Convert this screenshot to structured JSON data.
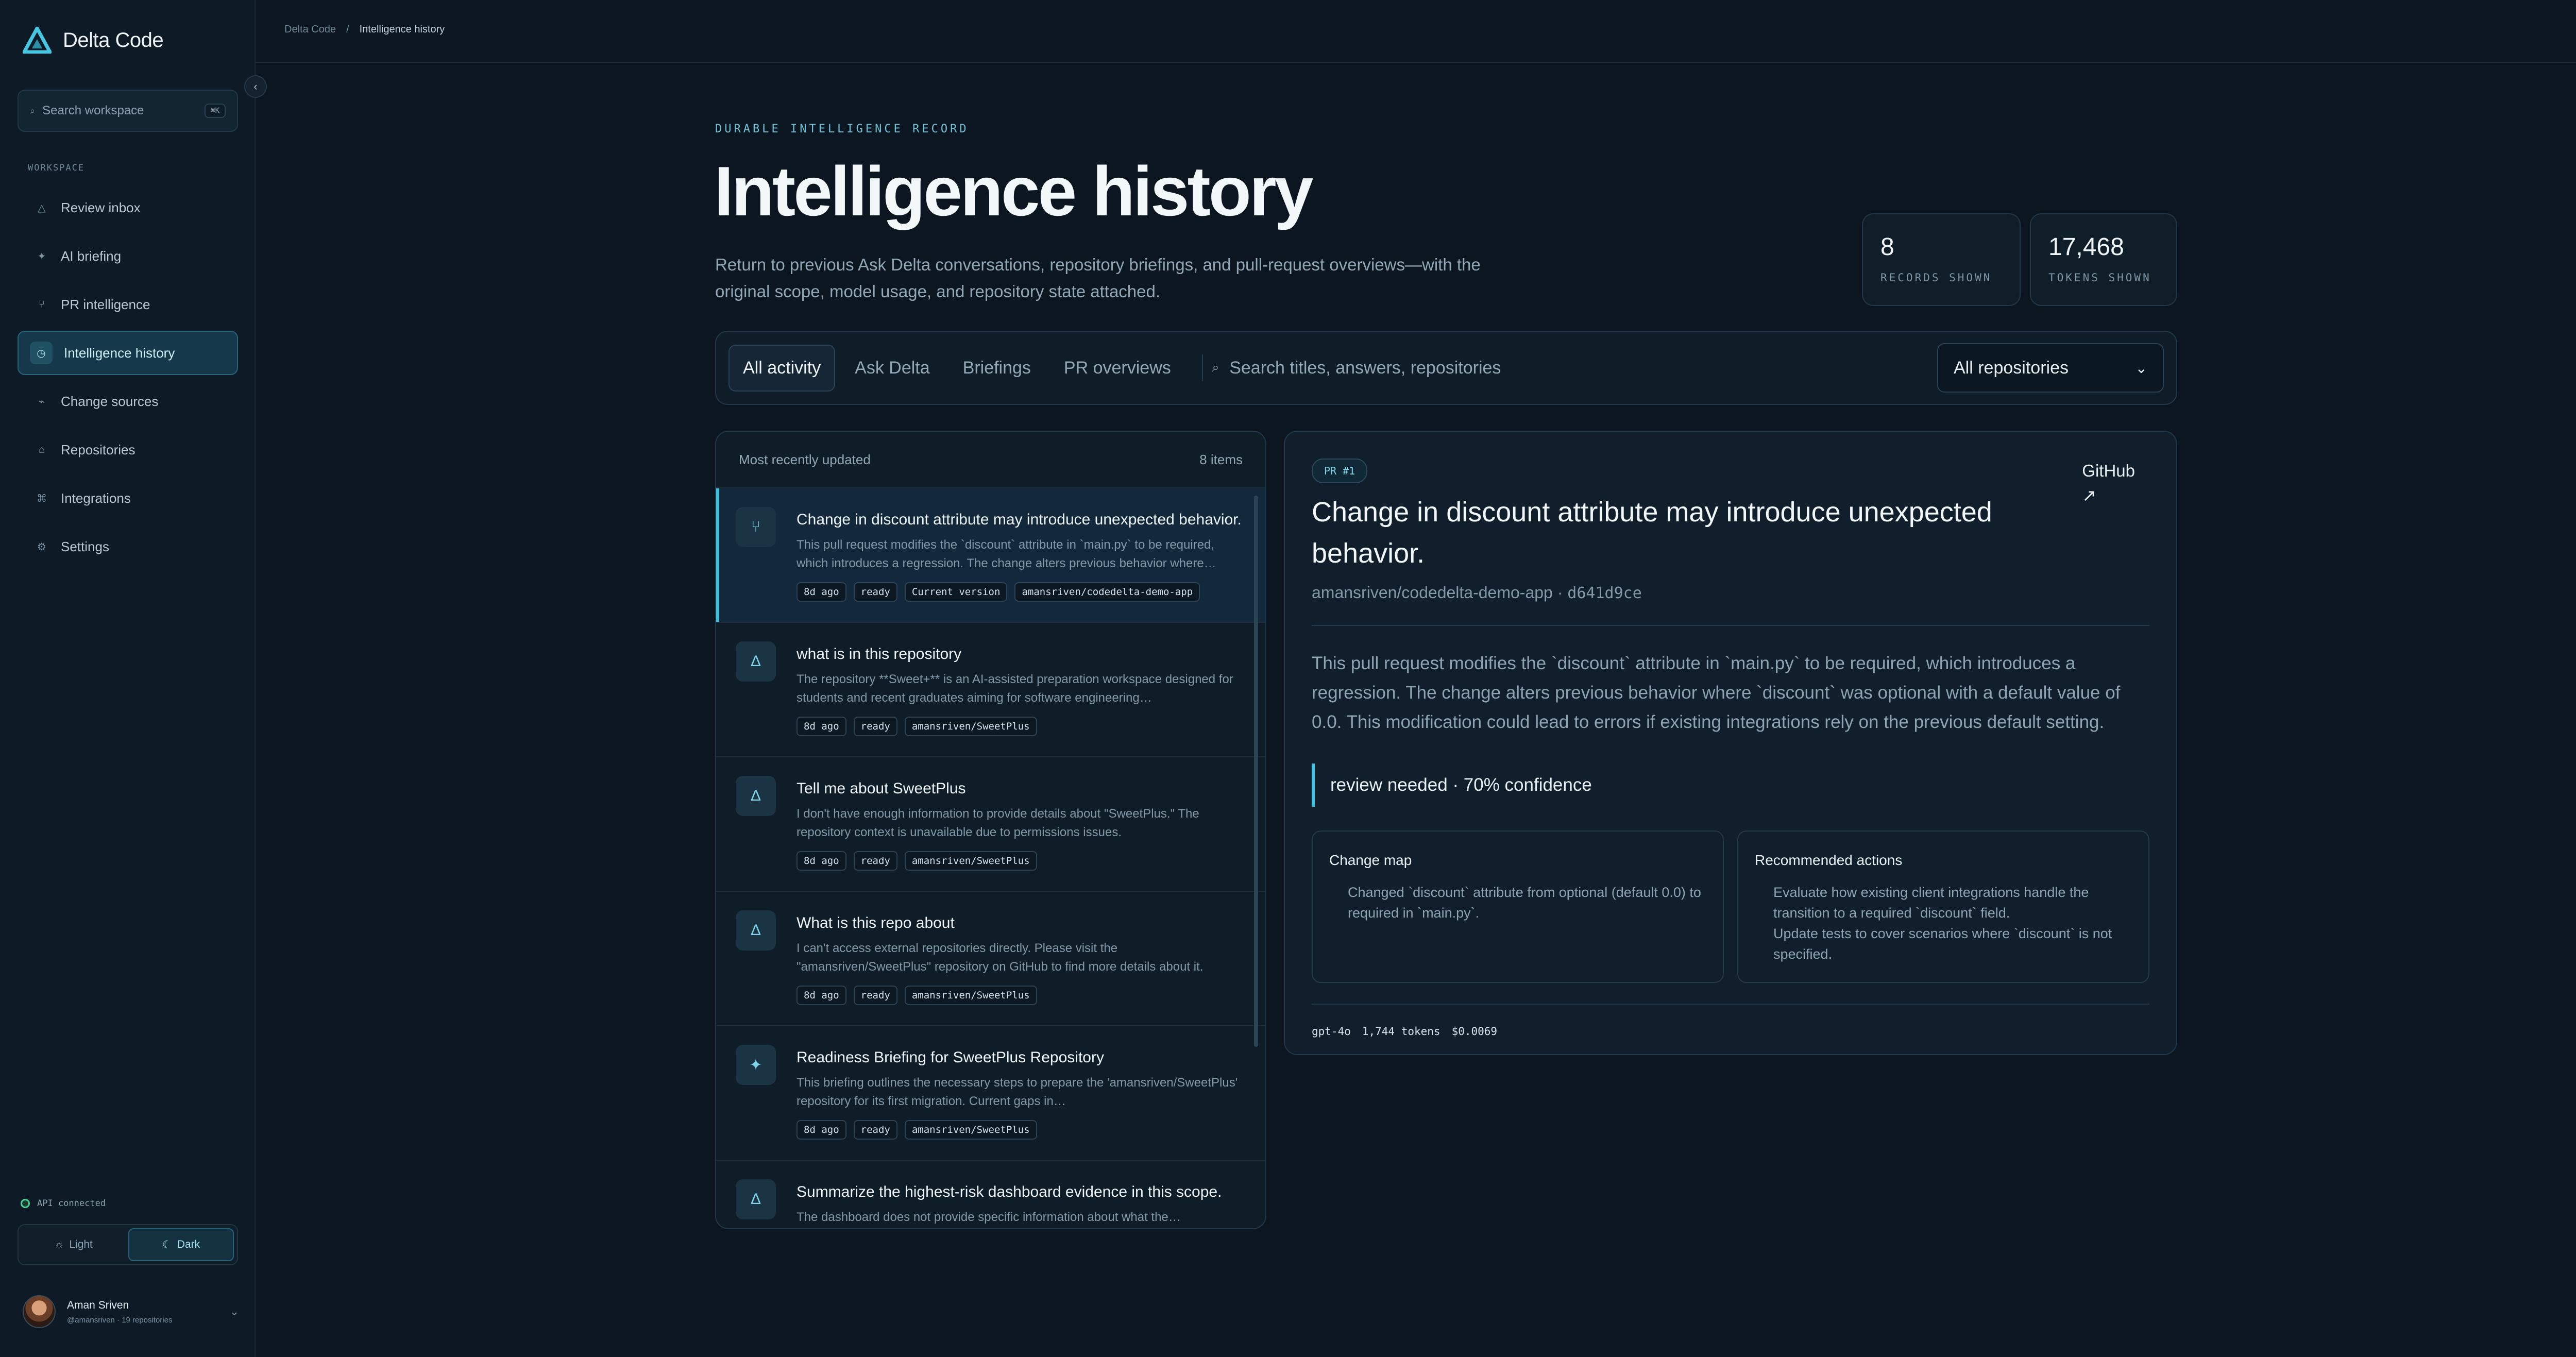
{
  "sidebar": {
    "brand": "Delta Code",
    "search_placeholder": "Search workspace",
    "search_kbd": "⌘K",
    "section_label": "WORKSPACE",
    "items": [
      {
        "label": "Review inbox",
        "icon": "△"
      },
      {
        "label": "AI briefing",
        "icon": "✦"
      },
      {
        "label": "PR intelligence",
        "icon": "⑂"
      },
      {
        "label": "Intelligence history",
        "icon": "◷"
      },
      {
        "label": "Change sources",
        "icon": "⌁"
      },
      {
        "label": "Repositories",
        "icon": "⌂"
      },
      {
        "label": "Integrations",
        "icon": "⌘"
      },
      {
        "label": "Settings",
        "icon": "⚙"
      }
    ],
    "api_status": "API connected",
    "theme_light": "Light",
    "theme_dark": "Dark",
    "user_name": "Aman Sriven",
    "user_sub": "@amansriven · 19 repositories"
  },
  "breadcrumb": {
    "root": "Delta Code",
    "current": "Intelligence history"
  },
  "header": {
    "eyebrow": "DURABLE INTELLIGENCE RECORD",
    "title": "Intelligence history",
    "subtitle": "Return to previous Ask Delta conversations, repository briefings, and pull-request overviews—with the original scope, model usage, and repository state attached."
  },
  "stats": [
    {
      "value": "8",
      "label": "RECORDS SHOWN"
    },
    {
      "value": "17,468",
      "label": "TOKENS SHOWN"
    }
  ],
  "filters": {
    "tabs": [
      "All activity",
      "Ask Delta",
      "Briefings",
      "PR overviews"
    ],
    "search_placeholder": "Search titles, answers, repositories",
    "repo_select": "All repositories"
  },
  "list": {
    "heading": "Most recently updated",
    "count": "8 items",
    "rows": [
      {
        "icon": "⑂",
        "title": "Change in discount attribute may introduce unexpected behavior.",
        "desc": "This pull request modifies the `discount` attribute in `main.py` to be required, which introduces a regression. The change alters previous behavior where…",
        "tags": [
          "8d ago",
          "ready",
          "Current version",
          "amansriven/codedelta-demo-app"
        ]
      },
      {
        "icon": "Δ",
        "title": "what is in this repository",
        "desc": "The repository **Sweet+** is an AI-assisted preparation workspace designed for students and recent graduates aiming for software engineering…",
        "tags": [
          "8d ago",
          "ready",
          "amansriven/SweetPlus"
        ]
      },
      {
        "icon": "Δ",
        "title": "Tell me about SweetPlus",
        "desc": "I don't have enough information to provide details about \"SweetPlus.\" The repository context is unavailable due to permissions issues.",
        "tags": [
          "8d ago",
          "ready",
          "amansriven/SweetPlus"
        ]
      },
      {
        "icon": "Δ",
        "title": "What is this repo about",
        "desc": "I can't access external repositories directly. Please visit the \"amansriven/SweetPlus\" repository on GitHub to find more details about it.",
        "tags": [
          "8d ago",
          "ready",
          "amansriven/SweetPlus"
        ]
      },
      {
        "icon": "✦",
        "title": "Readiness Briefing for SweetPlus Repository",
        "desc": "This briefing outlines the necessary steps to prepare the 'amansriven/SweetPlus' repository for its first migration. Current gaps in…",
        "tags": [
          "8d ago",
          "ready",
          "amansriven/SweetPlus"
        ]
      },
      {
        "icon": "Δ",
        "title": "Summarize the highest-risk dashboard evidence in this scope.",
        "desc": "The dashboard does not provide specific information about what the…",
        "tags": []
      }
    ]
  },
  "detail": {
    "badge": "PR #1",
    "github": "GitHub",
    "github_arrow": "↗",
    "title": "Change in discount attribute may introduce unexpected behavior.",
    "repo": "amansriven/codedelta-demo-app",
    "sha": "d641d9ce",
    "body": "This pull request modifies the `discount` attribute in `main.py` to be required, which introduces a regression. The change alters previous behavior where `discount` was optional with a default value of 0.0. This modification could lead to errors if existing integrations rely on the previous default setting.",
    "callout": "review needed · 70% confidence",
    "change_map_title": "Change map",
    "change_map": [
      "Changed `discount` attribute from optional (default 0.0) to required in `main.py`."
    ],
    "actions_title": "Recommended actions",
    "actions": [
      "Evaluate how existing client integrations handle the transition to a required `discount` field.",
      "Update tests to cover scenarios where `discount` is not specified."
    ],
    "model": "gpt-4o",
    "tokens": "1,744 tokens",
    "cost": "$0.0069"
  },
  "colors": {
    "accent": "#3ec2dd",
    "background": "#0b1620",
    "success": "#46d39a"
  }
}
